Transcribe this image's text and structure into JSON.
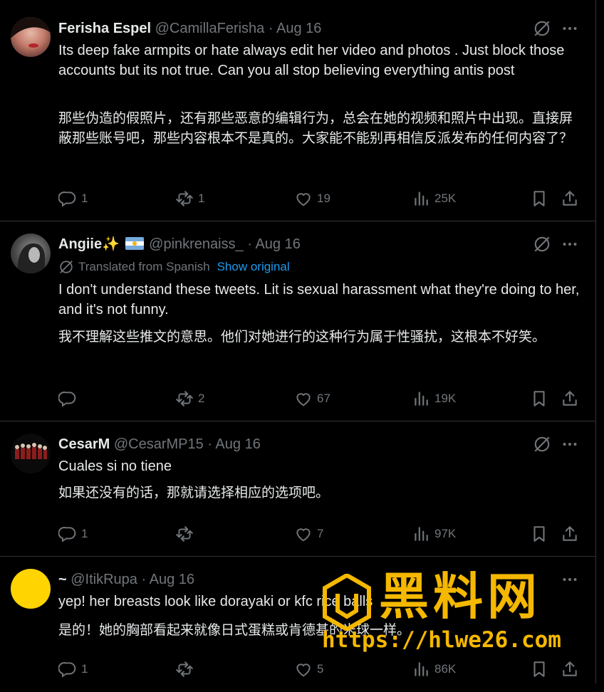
{
  "colors": {
    "background": "#000000",
    "text": "#e7e9ea",
    "muted": "#71767b",
    "link": "#1d9bf0",
    "border": "#2f3336",
    "watermark": "#f5b800"
  },
  "tweets": [
    {
      "name": "Ferisha Espel",
      "handle": "@CamillaFerisha",
      "dot": "·",
      "date": "Aug 16",
      "text_en": "Its deep fake armpits or hate always edit her video and photos . Just block those accounts but its not true. Can you all stop believing everything antis post",
      "text_zh": "那些伪造的假照片，还有那些恶意的编辑行为，总会在她的视频和照片中出现。直接屏蔽那些账号吧，那些内容根本不是真的。大家能不能别再相信反派发布的任何内容了？",
      "replies": "1",
      "reposts": "1",
      "likes": "19",
      "views": "25K"
    },
    {
      "name": "Angiie",
      "name_emoji": "✨",
      "handle": "@pinkrenaiss_",
      "dot": "·",
      "date": "Aug 16",
      "translated_label": "Translated from Spanish",
      "show_original": "Show original",
      "text_en": "I don't understand these tweets. Lit is sexual harassment what they're doing to her, and it's not funny.",
      "text_zh": "我不理解这些推文的意思。他们对她进行的这种行为属于性骚扰，这根本不好笑。",
      "replies": "",
      "reposts": "2",
      "likes": "67",
      "views": "19K"
    },
    {
      "name": "CesarM",
      "handle": "@CesarMP15",
      "dot": "·",
      "date": "Aug 16",
      "text_en": "Cuales si no tiene",
      "text_zh": "如果还没有的话，那就请选择相应的选项吧。",
      "replies": "1",
      "reposts": "",
      "likes": "7",
      "views": "97K"
    },
    {
      "name": "~",
      "handle": "@ItikRupa",
      "dot": "·",
      "date": "Aug 16",
      "text_en": "yep! her breasts look like dorayaki or kfc rice balls",
      "text_zh": "是的！她的胸部看起来就像日式蛋糕或肯德基的米球一样。",
      "replies": "1",
      "reposts": "",
      "likes": "5",
      "views": "86K"
    }
  ],
  "watermark": {
    "title": "黑料网",
    "url": "https://hlwe26.com"
  }
}
